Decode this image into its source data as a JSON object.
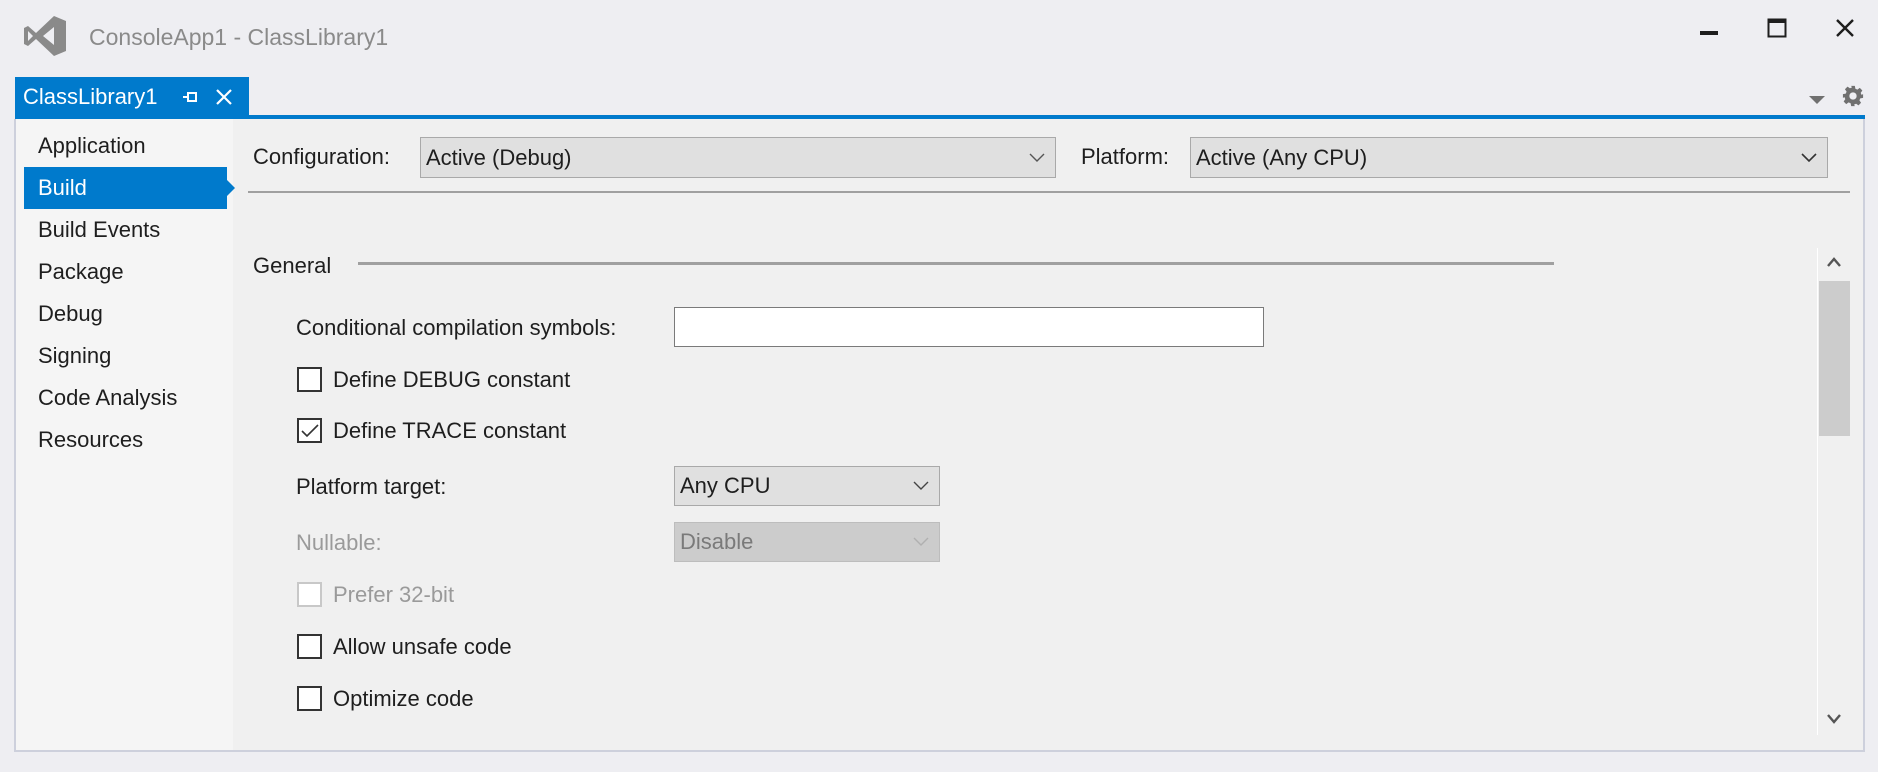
{
  "window": {
    "title": "ConsoleApp1 - ClassLibrary1",
    "controls": [
      "minimize",
      "maximize",
      "close"
    ]
  },
  "tab": {
    "label": "ClassLibrary1",
    "icons": [
      "pin-icon",
      "close-icon"
    ],
    "accent_color": "#007acc"
  },
  "sidebar": {
    "items": [
      {
        "label": "Application",
        "active": false
      },
      {
        "label": "Build",
        "active": true
      },
      {
        "label": "Build Events",
        "active": false
      },
      {
        "label": "Package",
        "active": false
      },
      {
        "label": "Debug",
        "active": false
      },
      {
        "label": "Signing",
        "active": false
      },
      {
        "label": "Code Analysis",
        "active": false
      },
      {
        "label": "Resources",
        "active": false
      }
    ]
  },
  "config_bar": {
    "configuration_label": "Configuration:",
    "configuration_value": "Active (Debug)",
    "platform_label": "Platform:",
    "platform_value": "Active (Any CPU)"
  },
  "general": {
    "section_title": "General",
    "conditional_symbols_label": "Conditional compilation symbols:",
    "conditional_symbols_value": "",
    "define_debug": {
      "label": "Define DEBUG constant",
      "checked": false,
      "enabled": true
    },
    "define_trace": {
      "label": "Define TRACE constant",
      "checked": true,
      "enabled": true
    },
    "platform_target_label": "Platform target:",
    "platform_target_value": "Any CPU",
    "nullable_label": "Nullable:",
    "nullable_value": "Disable",
    "prefer_32bit": {
      "label": "Prefer 32-bit",
      "checked": false,
      "enabled": false
    },
    "allow_unsafe": {
      "label": "Allow unsafe code",
      "checked": false,
      "enabled": true
    },
    "optimize": {
      "label": "Optimize code",
      "checked": false,
      "enabled": true
    }
  }
}
